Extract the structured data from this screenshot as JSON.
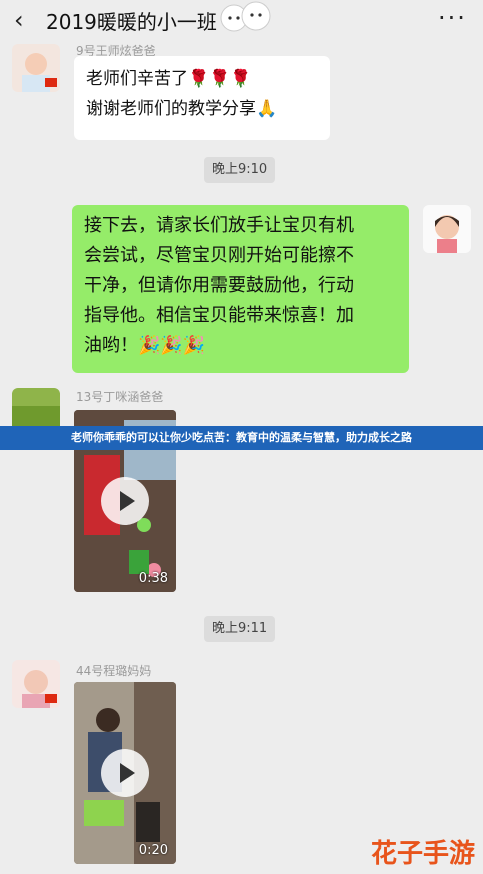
{
  "header": {
    "title": "2019暖暖的小一班",
    "back_icon": "‹",
    "more_icon": "···"
  },
  "messages": [
    {
      "sender": "9号王师炫爸爸",
      "lines": [
        "老师们辛苦了🌹🌹🌹",
        "谢谢老师们的教学分享🙏"
      ]
    },
    {
      "time": "晚上9:10"
    },
    {
      "self": true,
      "lines": [
        "接下去，请家长们放手让宝贝有机",
        "会尝试，尽管宝贝刚开始可能擦不",
        "干净，但请你用需要鼓励他，行动",
        "指导他。相信宝贝能带来惊喜！加",
        "油哟！🎉🎉🎉"
      ]
    },
    {
      "sender": "13号丁咪涵爸爸",
      "video_duration": "0:38"
    },
    {
      "time": "晚上9:11"
    },
    {
      "sender": "44号程璐妈妈",
      "video_duration": "0:20"
    }
  ],
  "overlay": {
    "banner_text": "老师你乖乖的可以让你少吃点苦：教育中的温柔与智慧，助力成长之路",
    "watermark": "花子手游"
  },
  "colors": {
    "background": "#ededed",
    "self_bubble": "#95ec69",
    "banner": "#1f64b8",
    "watermark": "#e8541b"
  }
}
